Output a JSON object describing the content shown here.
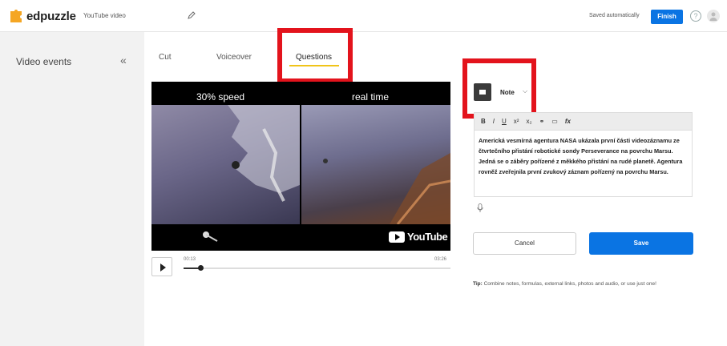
{
  "app": {
    "brand": "edpuzzle",
    "title": "YouTube video"
  },
  "header": {
    "saved_status": "Saved automatically",
    "finish_label": "Finish",
    "help_label": "?"
  },
  "sidebar": {
    "title": "Video events",
    "collapse_label": "«"
  },
  "tabs": [
    {
      "label": "Cut"
    },
    {
      "label": "Voiceover"
    },
    {
      "label": "Questions",
      "active": true
    }
  ],
  "video": {
    "label_left": "30% speed",
    "label_right": "real time",
    "brand": "YouTube",
    "current_time": "00:13",
    "total_time": "03:26",
    "progress": 0.063
  },
  "question": {
    "type_label": "Note",
    "toolbar": [
      "B",
      "I",
      "U",
      "x²",
      "x₂",
      "⚭",
      "▭",
      "fx"
    ],
    "body": "Americká vesmírná agentura NASA ukázala první části videozáznamu ze čtvrtečního přistání robotické sondy Perseverance na povrchu Marsu. Jedná se o záběry pořízené z měkkého přistání na rudé planetě. Agentura rovněž zveřejnila první zvukový záznam pořízený na povrchu Marsu."
  },
  "actions": {
    "cancel_label": "Cancel",
    "save_label": "Save"
  },
  "tip": {
    "prefix": "Tip:",
    "text": " Combine notes, formulas, external links, photos and audio, or use just one!"
  },
  "colors": {
    "accent": "#0a74e3",
    "highlight": "#e3131c",
    "tab_underline": "#f0c419"
  }
}
